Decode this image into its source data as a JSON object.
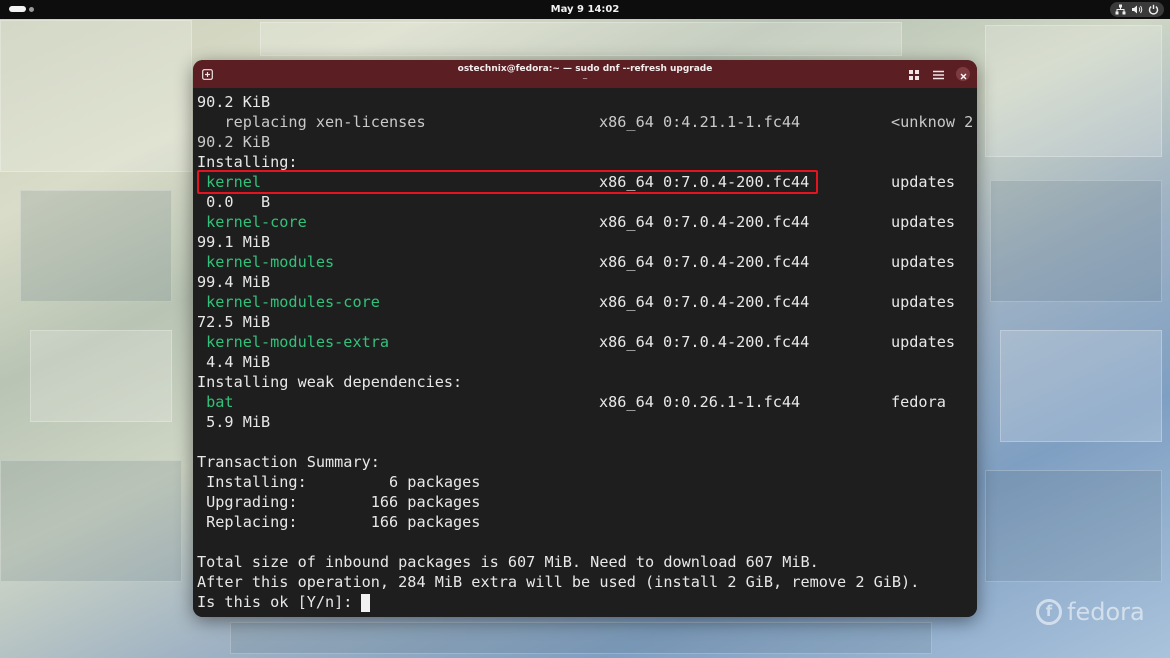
{
  "topbar": {
    "clock": "May 9  14:02",
    "icons": [
      "network-icon",
      "volume-icon",
      "power-icon"
    ]
  },
  "window": {
    "title": "ostechnix@fedora:~ — sudo dnf --refresh upgrade",
    "subtitle": "~"
  },
  "terminal": {
    "lines": [
      {
        "text": "90.2 KiB"
      },
      {
        "name": "   replacing xen-licenses",
        "arch_version": "x86_64 0:4.21.1-1.fc44",
        "repo": "<unknow 2"
      },
      {
        "text": "90.2 KiB"
      },
      {
        "text": "Installing:"
      },
      {
        "name": " kernel",
        "arch_version": "x86_64 0:7.0.4-200.fc44",
        "repo": "updates"
      },
      {
        "text": " 0.0   B"
      },
      {
        "name": " kernel-core",
        "arch_version": "x86_64 0:7.0.4-200.fc44",
        "repo": "updates"
      },
      {
        "text": "99.1 MiB"
      },
      {
        "name": " kernel-modules",
        "arch_version": "x86_64 0:7.0.4-200.fc44",
        "repo": "updates"
      },
      {
        "text": "99.4 MiB"
      },
      {
        "name": " kernel-modules-core",
        "arch_version": "x86_64 0:7.0.4-200.fc44",
        "repo": "updates"
      },
      {
        "text": "72.5 MiB"
      },
      {
        "name": " kernel-modules-extra",
        "arch_version": "x86_64 0:7.0.4-200.fc44",
        "repo": "updates"
      },
      {
        "text": " 4.4 MiB"
      },
      {
        "text": "Installing weak dependencies:"
      },
      {
        "name": " bat",
        "arch_version": "x86_64 0:0.26.1-1.fc44",
        "repo": "fedora"
      },
      {
        "text": " 5.9 MiB"
      },
      {
        "text": ""
      },
      {
        "text": "Transaction Summary:"
      },
      {
        "text": " Installing:         6 packages"
      },
      {
        "text": " Upgrading:        166 packages"
      },
      {
        "text": " Replacing:        166 packages"
      },
      {
        "text": ""
      },
      {
        "text": "Total size of inbound packages is 607 MiB. Need to download 607 MiB."
      },
      {
        "text": "After this operation, 284 MiB extra will be used (install 2 GiB, remove 2 GiB)."
      },
      {
        "text": "Is this ok [Y/n]: "
      }
    ]
  },
  "watermark": {
    "text": "fedora"
  }
}
